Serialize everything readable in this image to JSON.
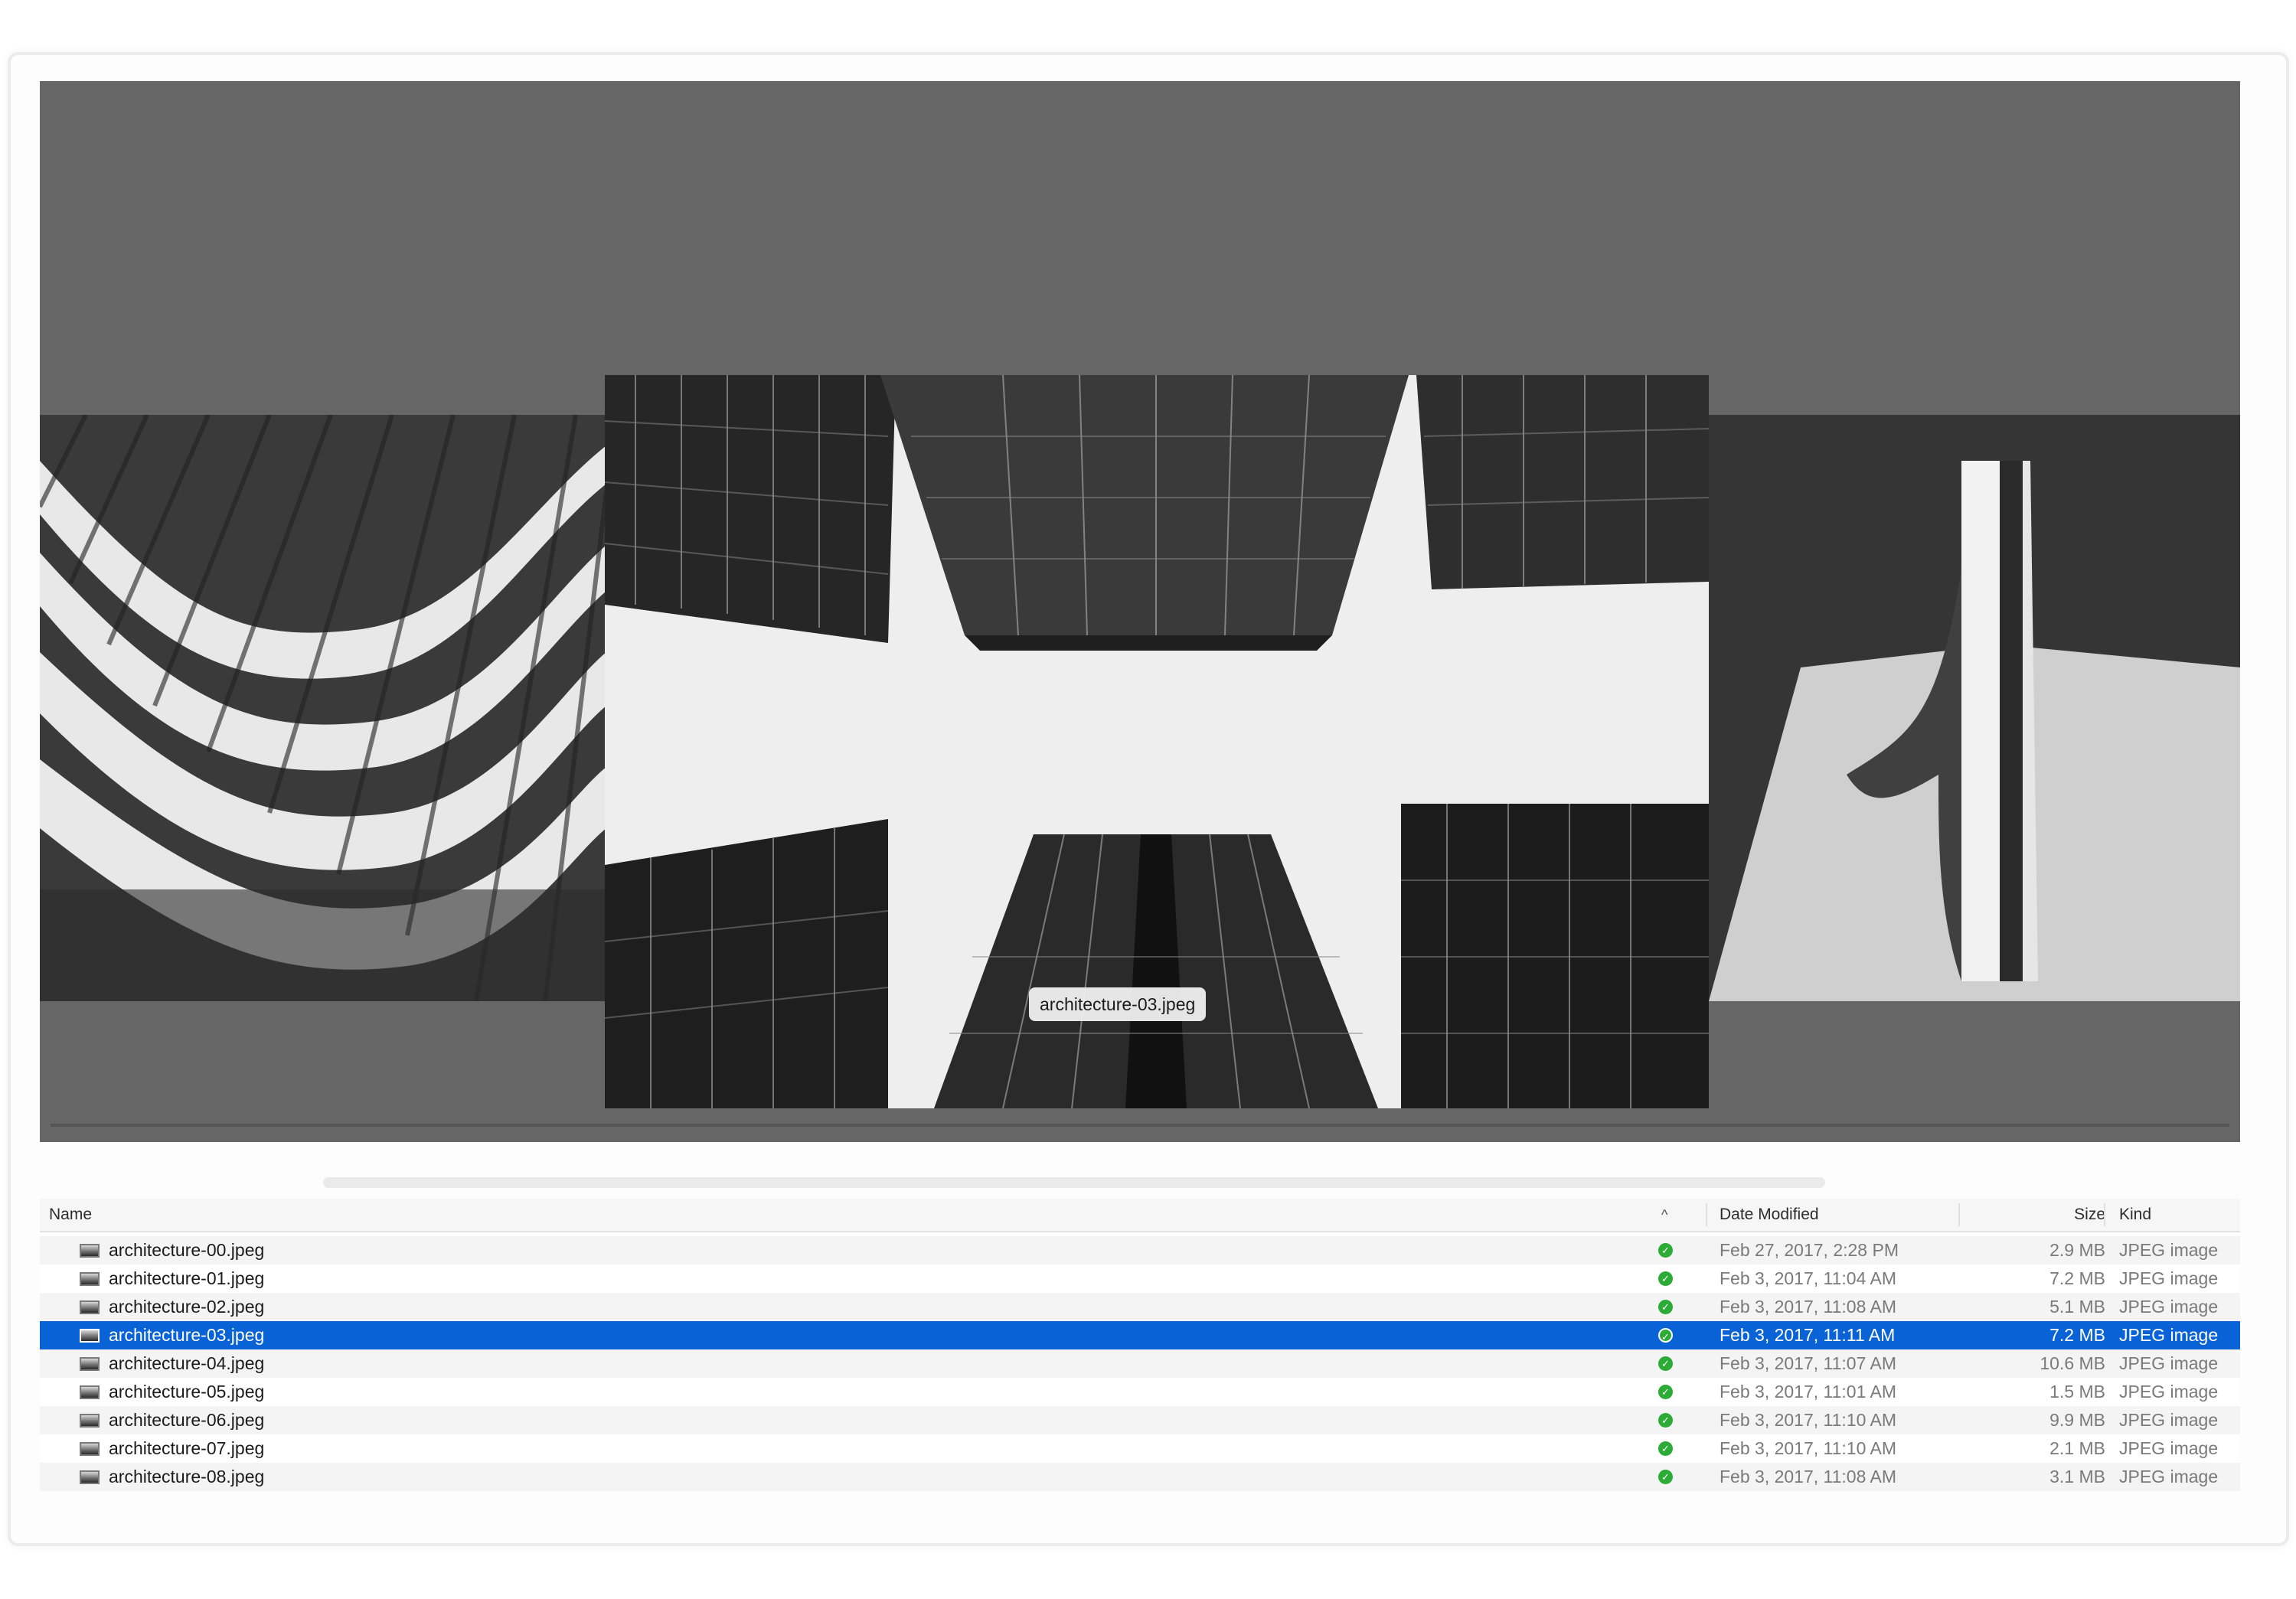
{
  "preview": {
    "caption": "architecture-03.jpeg"
  },
  "columns": {
    "name": "Name",
    "sort_indicator": "^",
    "date": "Date Modified",
    "size": "Size",
    "kind": "Kind"
  },
  "files": [
    {
      "name": "architecture-00.jpeg",
      "date": "Feb 27, 2017, 2:28 PM",
      "size": "2.9 MB",
      "kind": "JPEG image"
    },
    {
      "name": "architecture-01.jpeg",
      "date": "Feb 3, 2017, 11:04 AM",
      "size": "7.2 MB",
      "kind": "JPEG image"
    },
    {
      "name": "architecture-02.jpeg",
      "date": "Feb 3, 2017, 11:08 AM",
      "size": "5.1 MB",
      "kind": "JPEG image"
    },
    {
      "name": "architecture-03.jpeg",
      "date": "Feb 3, 2017, 11:11 AM",
      "size": "7.2 MB",
      "kind": "JPEG image"
    },
    {
      "name": "architecture-04.jpeg",
      "date": "Feb 3, 2017, 11:07 AM",
      "size": "10.6 MB",
      "kind": "JPEG image"
    },
    {
      "name": "architecture-05.jpeg",
      "date": "Feb 3, 2017, 11:01 AM",
      "size": "1.5 MB",
      "kind": "JPEG image"
    },
    {
      "name": "architecture-06.jpeg",
      "date": "Feb 3, 2017, 11:10 AM",
      "size": "9.9 MB",
      "kind": "JPEG image"
    },
    {
      "name": "architecture-07.jpeg",
      "date": "Feb 3, 2017, 11:10 AM",
      "size": "2.1 MB",
      "kind": "JPEG image"
    },
    {
      "name": "architecture-08.jpeg",
      "date": "Feb 3, 2017, 11:08 AM",
      "size": "3.1 MB",
      "kind": "JPEG image"
    }
  ],
  "selected_index": 3,
  "icons": {
    "status": "checkmark-circle-icon",
    "thumbnail": "image-thumbnail-icon"
  },
  "colors": {
    "selection": "#0963d6",
    "status_ok": "#2dab37",
    "coverflow_bg": "#666666"
  }
}
